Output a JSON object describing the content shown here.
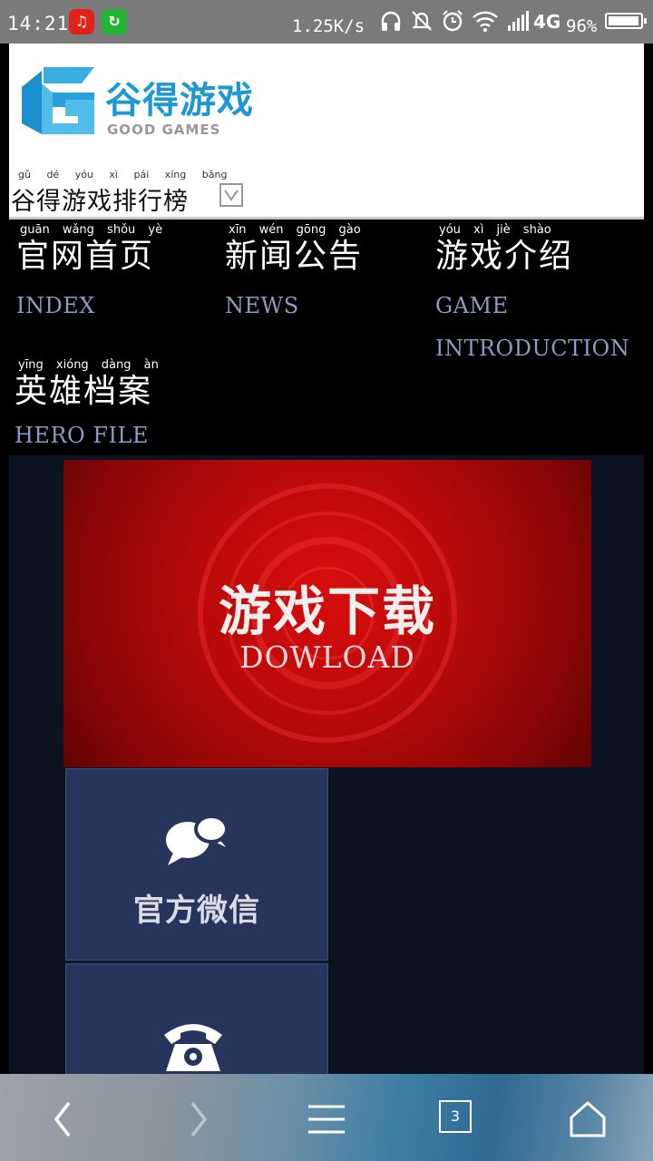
{
  "status_bar": {
    "time": "14:21",
    "speed": "1.25K/s",
    "network": "4G",
    "battery_pct": "96%",
    "battery_level": 0.96,
    "app_icons": [
      "netease-music-icon",
      "wechat-app-icon"
    ],
    "right_icons": [
      "headphones-icon",
      "bell-off-icon",
      "alarm-icon",
      "wifi-icon",
      "signal-icon"
    ]
  },
  "header": {
    "logo_cn": "谷得游戏",
    "logo_en": "GOOD GAMES",
    "rank_pinyin": "gǔ dé yóu xì pái xíng bǎng",
    "rank_label": "谷得游戏排行榜"
  },
  "nav": [
    {
      "pinyin": "guān wǎng shǒu yè",
      "cn": "官网首页",
      "en": "INDEX"
    },
    {
      "pinyin": "xīn wén gōng gào",
      "cn": "新闻公告",
      "en": "NEWS"
    },
    {
      "pinyin": "yóu xì jiè shào",
      "cn": "游戏介绍",
      "en": "GAME INTRODUCTION"
    },
    {
      "pinyin": "yīng xióng dàng àn",
      "cn": "英雄档案",
      "en": "HERO FILE"
    }
  ],
  "main": {
    "download_cn": "游戏下载",
    "download_en": "DOWLOAD",
    "wechat_label": "官方微信"
  },
  "bottom_bar": {
    "tab_count": "3",
    "buttons": [
      "back-icon",
      "forward-icon",
      "menu-icon",
      "tabs-icon",
      "home-icon"
    ]
  },
  "colors": {
    "status_bar_bg": "#7a7a7a",
    "page_bg": "#000000",
    "nav_en_text": "#8c9bc2",
    "main_panel_bg": "#0b1320",
    "banner_red": "#c00a0a",
    "tile_bg": "#27355c",
    "logo_blue": "#1d98d4"
  }
}
